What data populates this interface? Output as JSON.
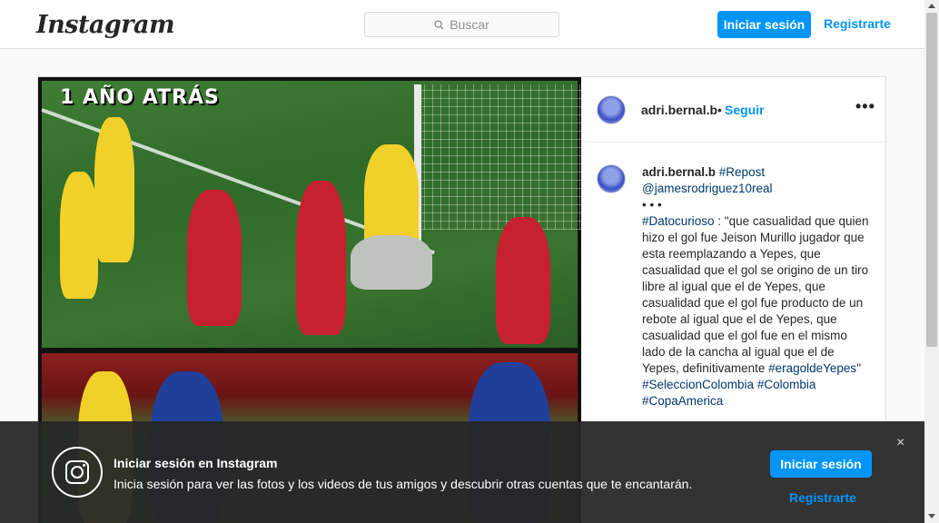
{
  "header": {
    "logo": "Instagram",
    "search_placeholder": "Buscar",
    "login_label": "Iniciar sesión",
    "register_label": "Registrarte"
  },
  "post": {
    "image_caption": "1 AÑO ATRÁS",
    "username": "adri.bernal.b",
    "separator": "•",
    "follow_label": "Seguir",
    "more_label": "•••",
    "comment": {
      "username": "adri.bernal.b",
      "repost_tag": "#Repost",
      "mention": "@jamesrodriguez10real",
      "dots": "• • •",
      "tag_datocurioso": "#Datocurioso",
      "body": " : \"que casualidad que quien hizo el gol fue Jeison Murillo jugador que esta reemplazando a Yepes, que casualidad que el gol se origino de un tiro libre al igual que el de Yepes, que casualidad que el gol fue producto de un rebote al igual que el de Yepes, que casualidad que el gol fue en el mismo lado de la cancha al igual que el de Yepes, definitivamente ",
      "tag_eragoldeyepes": "#eragoldeYepes",
      "quote_end": "\"",
      "tag_seleccion": "#SeleccionColombia",
      "tag_colombia": "#Colombia",
      "tag_copa": "#CopaAmerica"
    }
  },
  "banner": {
    "title": "Iniciar sesión en Instagram",
    "subtitle": "Inicia sesión para ver las fotos y los videos de tus amigos y descubrir otras cuentas que te encantarán.",
    "close": "×",
    "login_label": "Iniciar sesión",
    "register_label": "Registrarte"
  },
  "colors": {
    "accent": "#0095f6",
    "hashtag": "#00376b",
    "banner_bg": "#262626"
  },
  "icons": [
    "search-icon",
    "more-icon",
    "instagram-icon",
    "close-icon"
  ]
}
